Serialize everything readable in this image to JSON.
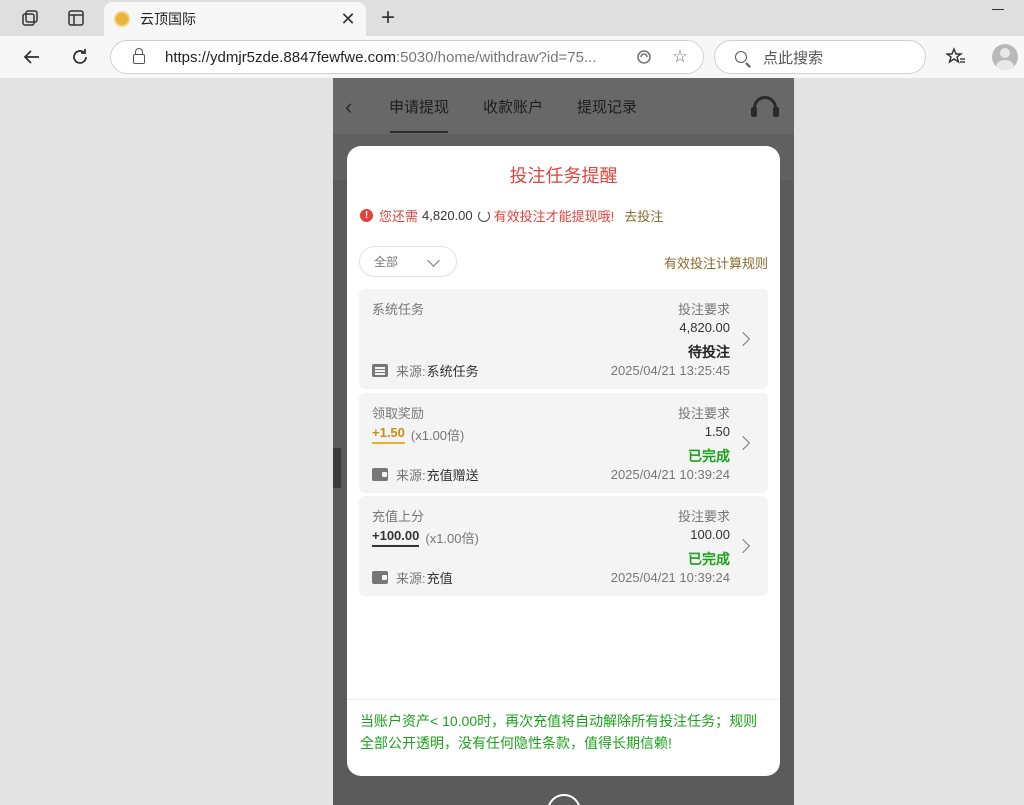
{
  "browser": {
    "tab_title": "云顶国际",
    "url_main": "https://ydmjr5zde.8847fewfwe.com",
    "url_rest": ":5030/home/withdraw?id=75...",
    "search_placeholder": "点此搜索"
  },
  "app": {
    "tabs": [
      "申请提现",
      "收款账户",
      "提现记录"
    ]
  },
  "modal": {
    "title": "投注任务提醒",
    "warning_prefix": "您还需",
    "warning_amount": "4,820.00",
    "warning_suffix": "有效投注才能提现哦!",
    "warning_link": "去投注",
    "filter_label": "全部",
    "rules_link": "有效投注计算规则",
    "tasks": [
      {
        "type": "系统任务",
        "bonus": "",
        "multiplier": "",
        "req_label": "投注要求",
        "req_amount": "4,820.00",
        "status": "待投注",
        "source_label": "来源:",
        "source": "系统任务",
        "time": "2025/04/21 13:25:45"
      },
      {
        "type": "领取奖励",
        "bonus": "+1.50",
        "multiplier": "(x1.00倍)",
        "req_label": "投注要求",
        "req_amount": "1.50",
        "status": "已完成",
        "source_label": "来源:",
        "source": "充值赠送",
        "time": "2025/04/21 10:39:24"
      },
      {
        "type": "充值上分",
        "bonus": "+100.00",
        "multiplier": "(x1.00倍)",
        "req_label": "投注要求",
        "req_amount": "100.00",
        "status": "已完成",
        "source_label": "来源:",
        "source": "充值",
        "time": "2025/04/21 10:39:24"
      }
    ],
    "footer_note": "当账户资产< 10.00时，再次充值将自动解除所有投注任务；规则全部公开透明，没有任何隐性条款，值得长期信赖!"
  },
  "colors": {
    "alert_red": "#e0433b",
    "success_green": "#1aa31a",
    "link_gold": "#8a6a2a",
    "bonus_gold": "#c9900f"
  },
  "icons": [
    "workspaces-icon",
    "tab-actions-icon",
    "back-arrow-icon",
    "refresh-icon",
    "lock-icon",
    "read-aloud-icon",
    "star-icon",
    "search-icon",
    "favorites-icon",
    "profile-icon",
    "headset-icon"
  ]
}
